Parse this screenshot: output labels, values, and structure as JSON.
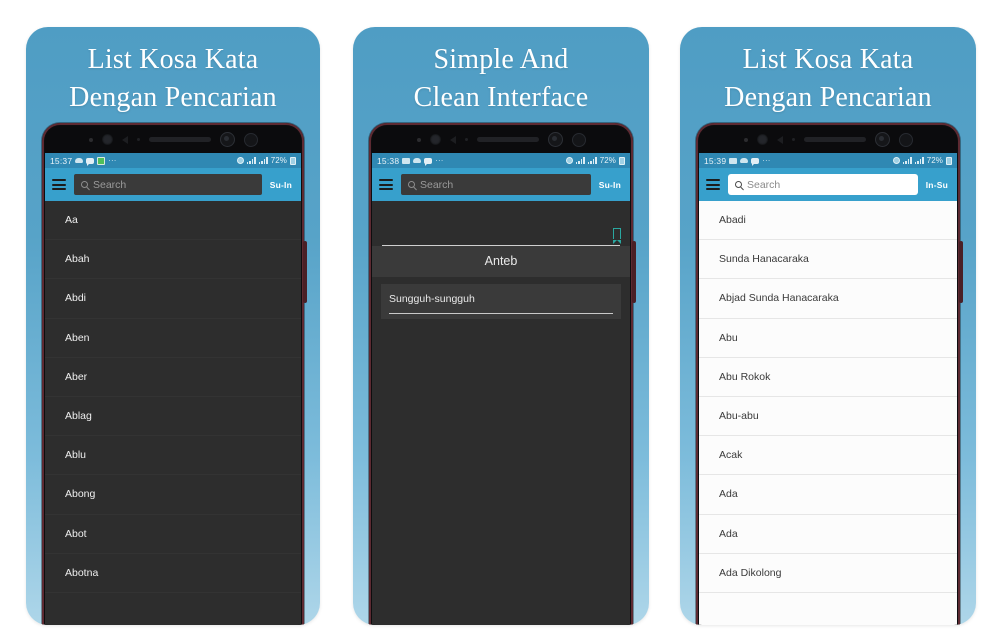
{
  "panels": [
    {
      "headline": "List Kosa Kata\nDengan Pencarian",
      "status": {
        "time": "15:37",
        "battery": "72%",
        "dots": "···",
        "icons": [
          "cloud-icon",
          "chat-icon",
          "green-app-icon",
          "more-icon",
          "alarm-icon",
          "signal-icon",
          "battery-icon"
        ]
      },
      "appbar": {
        "menu": "hamburger-icon",
        "search_placeholder": "Search",
        "search_value": "",
        "lang_button": "Su-In"
      },
      "theme": "dark",
      "view": "list",
      "list": [
        "Aa",
        "Abah",
        "Abdi",
        "Aben",
        "Aber",
        "Ablag",
        "Ablu",
        "Abong",
        "Abot",
        "Abotna"
      ]
    },
    {
      "headline": "Simple And\nClean Interface",
      "status": {
        "time": "15:38",
        "battery": "72%",
        "dots": "···",
        "icons": [
          "photo-icon",
          "cloud-icon",
          "chat-icon",
          "more-icon",
          "alarm-icon",
          "signal-icon",
          "battery-icon"
        ]
      },
      "appbar": {
        "menu": "hamburger-icon",
        "search_placeholder": "Search",
        "search_value": "",
        "lang_button": "Su-In"
      },
      "theme": "dark",
      "view": "detail",
      "detail": {
        "bookmark_icon": "bookmark-icon",
        "title": "Anteb",
        "definition": "Sungguh-sungguh"
      }
    },
    {
      "headline": "List Kosa Kata\nDengan Pencarian",
      "status": {
        "time": "15:39",
        "battery": "72%",
        "dots": "···",
        "icons": [
          "photo-icon",
          "cloud-icon",
          "chat-icon",
          "more-icon",
          "alarm-icon",
          "signal-icon",
          "battery-icon"
        ]
      },
      "appbar": {
        "menu": "hamburger-icon",
        "search_placeholder": "Search",
        "search_value": "",
        "lang_button": "In-Su"
      },
      "theme": "light",
      "view": "list",
      "list": [
        "Abadi",
        "Sunda Hanacaraka",
        "Abjad Sunda Hanacaraka",
        "Abu",
        "Abu Rokok",
        "Abu-abu",
        "Acak",
        "Ada",
        "Ada",
        "Ada Dikolong"
      ]
    }
  ],
  "colors": {
    "card_blue_top": "#4f9dc4",
    "card_blue_bottom": "#aed6e9",
    "appbar_blue": "#37a0cc",
    "statusbar_blue": "#2f88b3",
    "dark_screen": "#2d2d2d",
    "light_screen": "#fcfcfc",
    "bookmark_teal": "#2aa7a0",
    "bezel_red": "#5d2a32"
  }
}
